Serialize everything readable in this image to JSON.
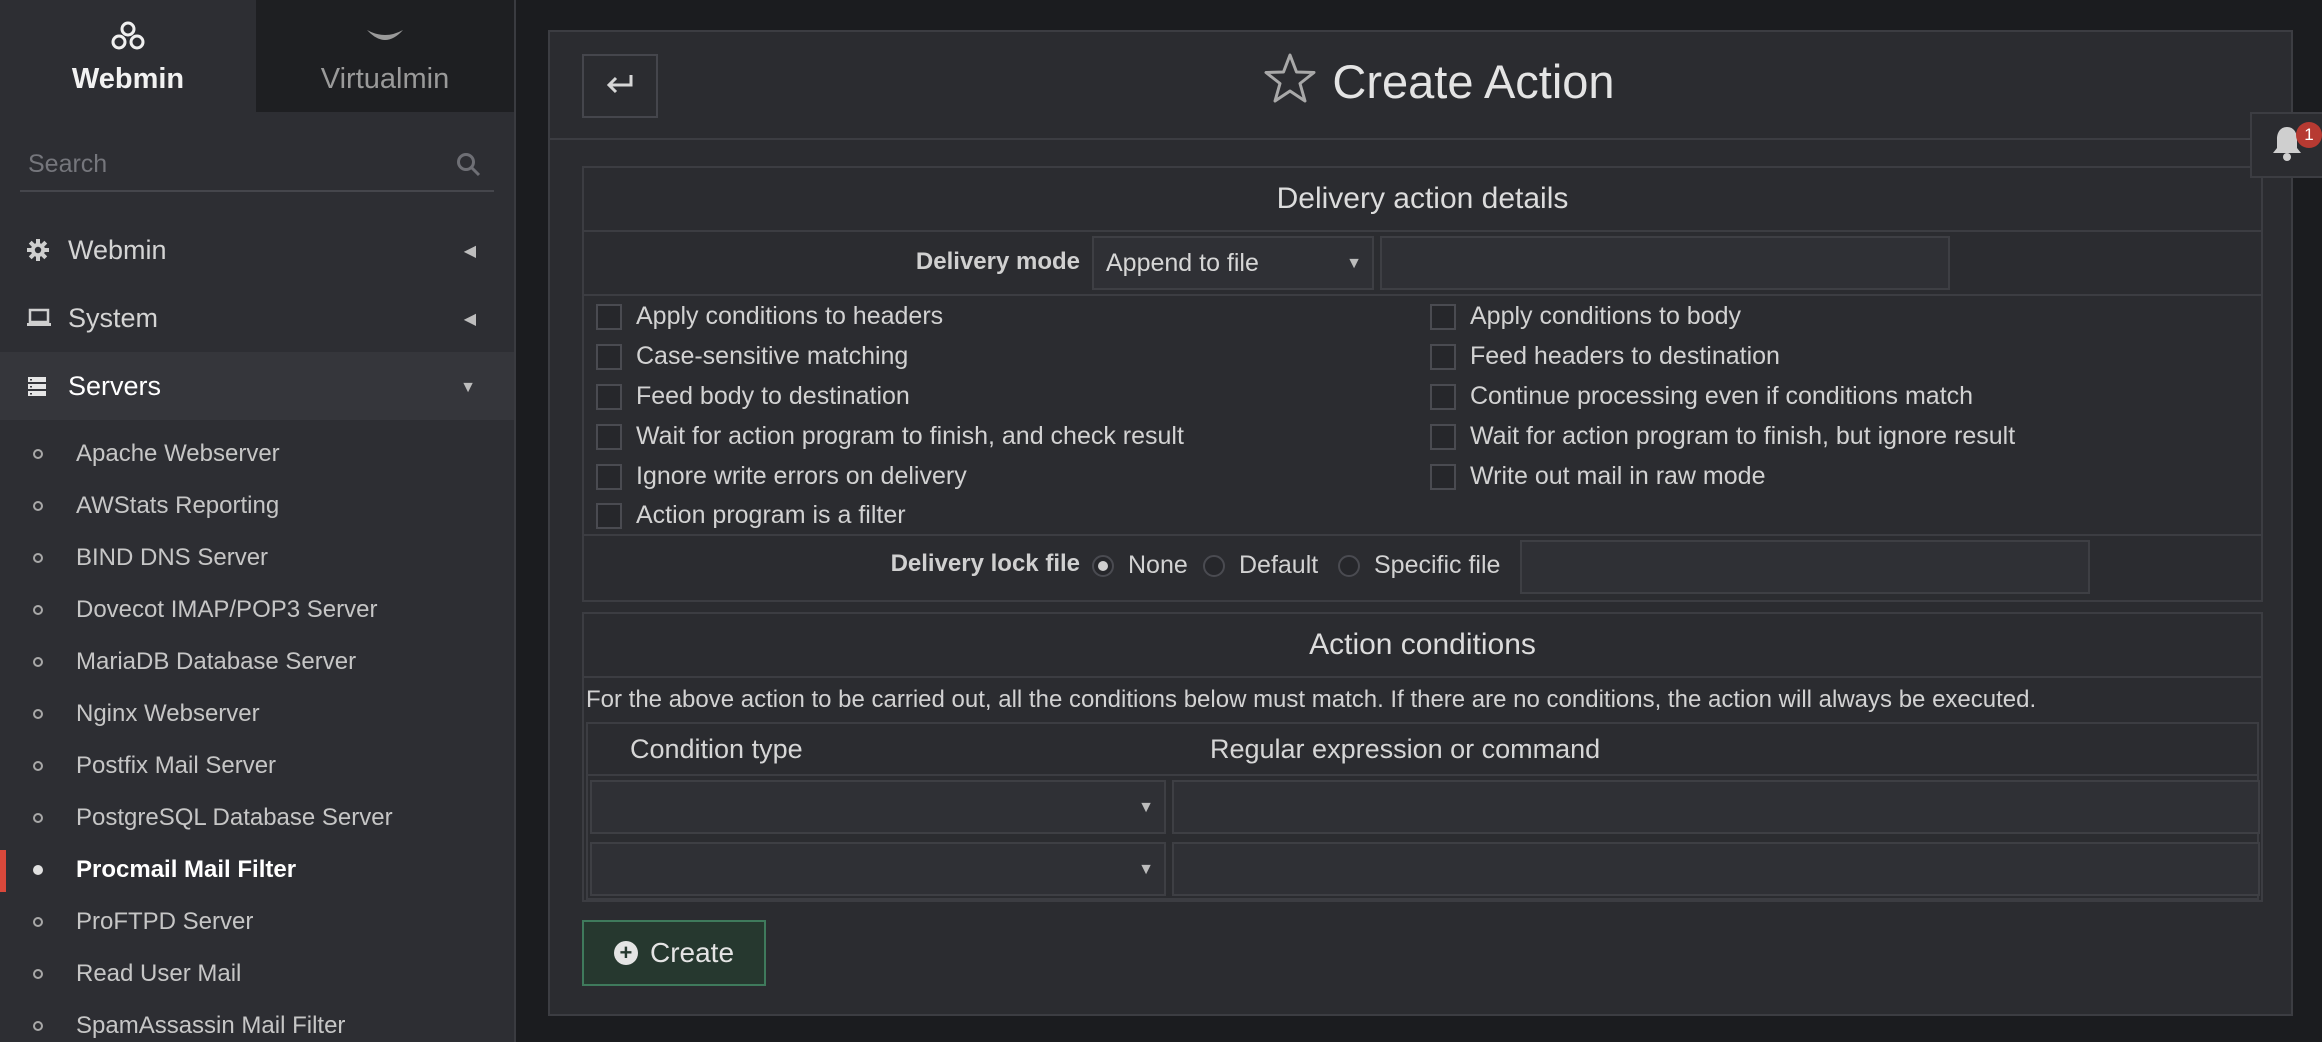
{
  "sidebar": {
    "tabs": [
      {
        "label": "Webmin",
        "icon": "webmin-logo-icon",
        "active": true
      },
      {
        "label": "Virtualmin",
        "icon": "virtualmin-logo-icon",
        "active": false
      }
    ],
    "search": {
      "placeholder": "Search",
      "value": ""
    },
    "categories": [
      {
        "label": "Webmin",
        "icon": "gear-icon",
        "state": "collapsed"
      },
      {
        "label": "System",
        "icon": "laptop-icon",
        "state": "collapsed"
      },
      {
        "label": "Servers",
        "icon": "server-icon",
        "state": "expanded"
      }
    ],
    "server_items": [
      "Apache Webserver",
      "AWStats Reporting",
      "BIND DNS Server",
      "Dovecot IMAP/POP3 Server",
      "MariaDB Database Server",
      "Nginx Webserver",
      "Postfix Mail Server",
      "PostgreSQL Database Server",
      "Procmail Mail Filter",
      "ProFTPD Server",
      "Read User Mail",
      "SpamAssassin Mail Filter"
    ],
    "active_item": "Procmail Mail Filter"
  },
  "header": {
    "title": "Create Action",
    "back_icon": "return-arrow-icon",
    "star_icon": "star-outline-icon"
  },
  "notifications": {
    "count": "1",
    "icon": "bell-icon"
  },
  "delivery": {
    "section_title": "Delivery action details",
    "mode_label": "Delivery mode",
    "mode_value": "Append to file",
    "mode_text": "",
    "options_left": [
      {
        "label": "Apply conditions to headers",
        "checked": false
      },
      {
        "label": "Case-sensitive matching",
        "checked": false
      },
      {
        "label": "Feed body to destination",
        "checked": false
      },
      {
        "label": "Wait for action program to finish, and check result",
        "checked": false
      },
      {
        "label": "Ignore write errors on delivery",
        "checked": false
      },
      {
        "label": "Action program is a filter",
        "checked": false
      }
    ],
    "options_right": [
      {
        "label": "Apply conditions to body",
        "checked": false
      },
      {
        "label": "Feed headers to destination",
        "checked": false
      },
      {
        "label": "Continue processing even if conditions match",
        "checked": false
      },
      {
        "label": "Wait for action program to finish, but ignore result",
        "checked": false
      },
      {
        "label": "Write out mail in raw mode",
        "checked": false
      }
    ],
    "lock_label": "Delivery lock file",
    "lock_options": [
      {
        "label": "None",
        "selected": true
      },
      {
        "label": "Default",
        "selected": false
      },
      {
        "label": "Specific file",
        "selected": false
      }
    ],
    "lock_file": ""
  },
  "conditions": {
    "section_title": "Action conditions",
    "description": "For the above action to be carried out, all the conditions below must match. If there are no conditions, the action will always be executed.",
    "col_type": "Condition type",
    "col_expr": "Regular expression or command",
    "rows": [
      {
        "type": "",
        "expr": ""
      },
      {
        "type": "",
        "expr": ""
      }
    ]
  },
  "actions": {
    "create_label": "Create"
  }
}
